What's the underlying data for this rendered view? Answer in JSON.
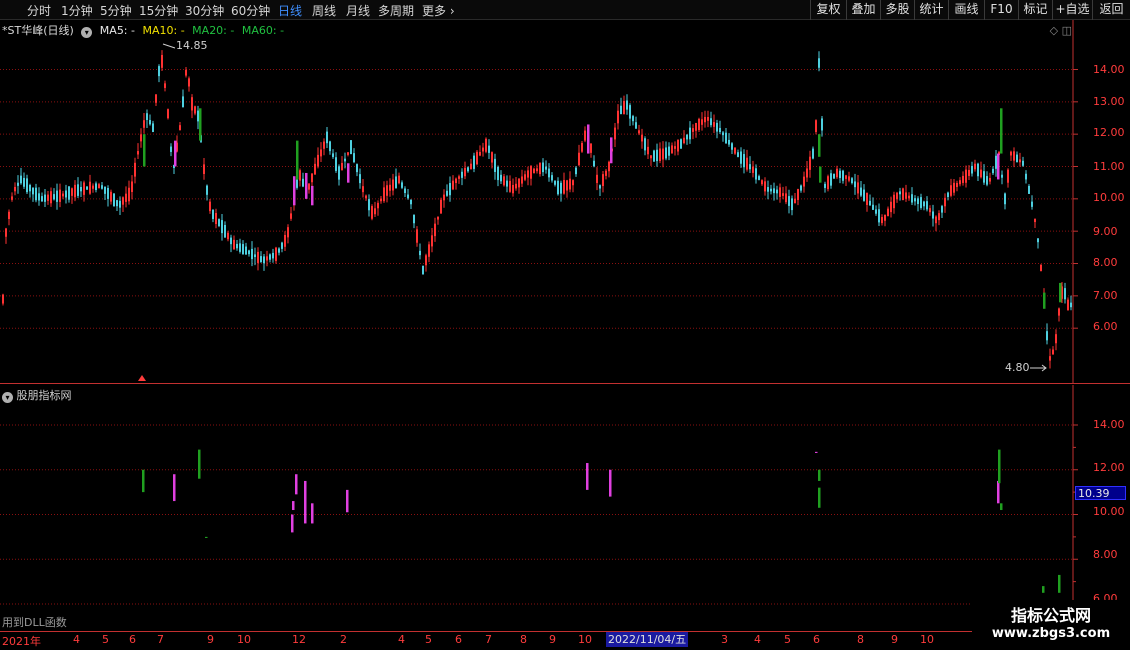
{
  "toolbar": {
    "periods": [
      "分时",
      "1分钟",
      "5分钟",
      "15分钟",
      "30分钟",
      "60分钟",
      "日线",
      "周线",
      "月线",
      "多周期",
      "更多"
    ],
    "active_period": "日线",
    "more_arrow": "›",
    "right_buttons": [
      "复权",
      "叠加",
      "多股",
      "统计",
      "画线",
      "F10",
      "标记",
      "+自选",
      "返回"
    ]
  },
  "main": {
    "stock_title": "*ST华峰(日线)",
    "ma5": "MA5: -",
    "ma10": "MA10: -",
    "ma20": "MA20: -",
    "ma60": "MA60: -",
    "controls": "◇ ◫",
    "high_label": "14.85",
    "low_label": "4.80",
    "y_ticks": [
      "14.00",
      "13.00",
      "12.00",
      "11.00",
      "10.00",
      "9.00",
      "8.00",
      "7.00",
      "6.00"
    ]
  },
  "indicator": {
    "title": "股朋指标网",
    "y_ticks": [
      "14.00",
      "12.00",
      "10.00",
      "8.00",
      "6.00"
    ],
    "current_price": "10.39",
    "dll_note": "用到DLL函数"
  },
  "date_axis": {
    "labels": [
      "2021年",
      "4",
      "5",
      "6",
      "7",
      "9",
      "10",
      "12",
      "2",
      "4",
      "5",
      "6",
      "7",
      "8",
      "9",
      "10",
      "3",
      "4",
      "5",
      "6",
      "8",
      "9",
      "10"
    ],
    "cursor_date": "2022/11/04/五"
  },
  "watermark": {
    "line1": "指标公式网",
    "line2": "www.zbgs3.com"
  },
  "colors": {
    "background": "#000000",
    "up": "#ff3232",
    "down": "#4ed0e0",
    "grid": "#8a1010",
    "axis_text": "#ff3c3c",
    "ma5": "#e8e8e8",
    "ma10": "#f0e000",
    "ma20": "#20c040",
    "ma60": "#20c040",
    "signal_magenta": "#e040e0",
    "signal_green": "#20a020"
  }
}
